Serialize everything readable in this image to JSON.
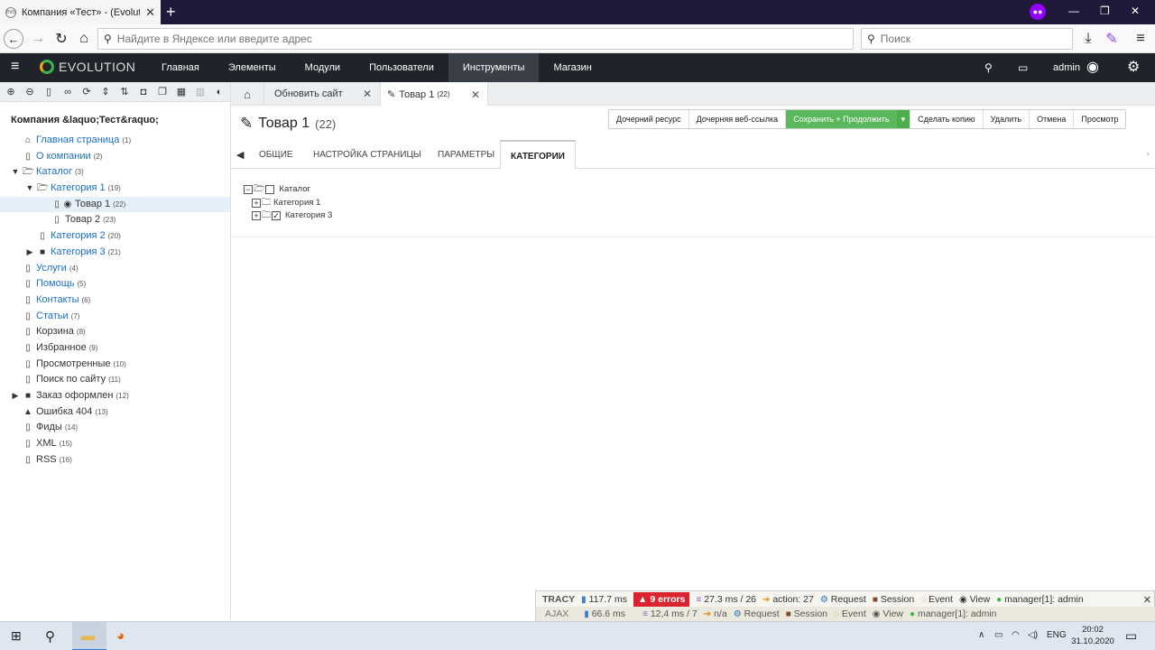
{
  "browser": {
    "tab_title": "Компания «Тест» - (Evolution",
    "favicon_label": "evo",
    "address_placeholder": "Найдите в Яндексе или введите адрес",
    "search_placeholder": "Поиск"
  },
  "evo_menu": {
    "logo": "EVOLUTION",
    "items": [
      "Главная",
      "Элементы",
      "Модули",
      "Пользователи",
      "Инструменты",
      "Магазин"
    ],
    "active_index": 4,
    "user": "admin"
  },
  "sidebar": {
    "site_title": "Компания &laquo;Тест&raquo;",
    "tree": [
      {
        "label": "Главная страница",
        "count": "(1)",
        "depth": 0,
        "toggle": "",
        "icon": "home",
        "link": true,
        "selected": false
      },
      {
        "label": "О компании",
        "count": "(2)",
        "depth": 0,
        "toggle": "",
        "icon": "file",
        "link": true,
        "selected": false
      },
      {
        "label": "Каталог",
        "count": "(3)",
        "depth": 0,
        "toggle": "down",
        "icon": "folder-open",
        "link": true,
        "selected": false
      },
      {
        "label": "Категория 1",
        "count": "(19)",
        "depth": 1,
        "toggle": "down",
        "icon": "folder-open",
        "link": true,
        "selected": false
      },
      {
        "label": "Товар 1",
        "count": "(22)",
        "depth": 2,
        "toggle": "",
        "icon": "file-eye",
        "link": false,
        "selected": true
      },
      {
        "label": "Товар 2",
        "count": "(23)",
        "depth": 2,
        "toggle": "",
        "icon": "file",
        "link": false,
        "selected": false
      },
      {
        "label": "Категория 2",
        "count": "(20)",
        "depth": 1,
        "toggle": "",
        "icon": "file",
        "link": true,
        "selected": false
      },
      {
        "label": "Категория 3",
        "count": "(21)",
        "depth": 1,
        "toggle": "right",
        "icon": "folder",
        "link": true,
        "selected": false
      },
      {
        "label": "Услуги",
        "count": "(4)",
        "depth": 0,
        "toggle": "",
        "icon": "file",
        "link": true,
        "selected": false
      },
      {
        "label": "Помощь",
        "count": "(5)",
        "depth": 0,
        "toggle": "",
        "icon": "file",
        "link": true,
        "selected": false
      },
      {
        "label": "Контакты",
        "count": "(6)",
        "depth": 0,
        "toggle": "",
        "icon": "file",
        "link": true,
        "selected": false
      },
      {
        "label": "Статьи",
        "count": "(7)",
        "depth": 0,
        "toggle": "",
        "icon": "file",
        "link": true,
        "selected": false
      },
      {
        "label": "Корзина",
        "count": "(8)",
        "depth": 0,
        "toggle": "",
        "icon": "file",
        "link": false,
        "selected": false
      },
      {
        "label": "Избранное",
        "count": "(9)",
        "depth": 0,
        "toggle": "",
        "icon": "file",
        "link": false,
        "selected": false
      },
      {
        "label": "Просмотренные",
        "count": "(10)",
        "depth": 0,
        "toggle": "",
        "icon": "file",
        "link": false,
        "selected": false
      },
      {
        "label": "Поиск по сайту",
        "count": "(11)",
        "depth": 0,
        "toggle": "",
        "icon": "file",
        "link": false,
        "selected": false
      },
      {
        "label": "Заказ оформлен",
        "count": "(12)",
        "depth": 0,
        "toggle": "right",
        "icon": "folder",
        "link": false,
        "selected": false
      },
      {
        "label": "Ошибка 404",
        "count": "(13)",
        "depth": 0,
        "toggle": "",
        "icon": "warning",
        "link": false,
        "selected": false
      },
      {
        "label": "Фиды",
        "count": "(14)",
        "depth": 0,
        "toggle": "",
        "icon": "file",
        "link": false,
        "selected": false
      },
      {
        "label": "XML",
        "count": "(15)",
        "depth": 0,
        "toggle": "",
        "icon": "file-code",
        "link": false,
        "selected": false
      },
      {
        "label": "RSS",
        "count": "(16)",
        "depth": 0,
        "toggle": "",
        "icon": "file-code",
        "link": false,
        "selected": false
      }
    ]
  },
  "content_tabs": {
    "tab1": "Обновить сайт",
    "tab2_title": "Товар 1",
    "tab2_count": "(22)"
  },
  "document": {
    "title": "Товар 1",
    "id": "(22)",
    "actions": [
      "Дочерний ресурс",
      "Дочерняя веб-ссылка",
      "Сохранить + Продолжить",
      "Сделать копию",
      "Удалить",
      "Отмена",
      "Просмотр"
    ],
    "tabs": [
      "ОБЩИЕ",
      "НАСТРОЙКА СТРАНИЦЫ",
      "ПАРАМЕТРЫ",
      "КАТЕГОРИИ"
    ],
    "active_tab": 3
  },
  "categories_tree": [
    {
      "label": "Каталог",
      "expander": "−",
      "checked": false,
      "depth": 0,
      "open": true
    },
    {
      "label": "Категория 1",
      "expander": "+",
      "checked": null,
      "depth": 1,
      "open": false
    },
    {
      "label": "Категория 3",
      "expander": "+",
      "checked": true,
      "depth": 1,
      "open": false
    }
  ],
  "tracy": {
    "row1": {
      "brand": "TRACY",
      "time": "117.7 ms",
      "errors": "9 errors",
      "db": "27.3 ms / 26",
      "action": "action: 27",
      "request": "Request",
      "session": "Session",
      "event": "Event",
      "view": "View",
      "user": "manager[1]: admin"
    },
    "row2": {
      "brand": "AJAX",
      "time": "66.6 ms",
      "db": "12,4 ms / 7",
      "action": "n/a",
      "request": "Request",
      "session": "Session",
      "event": "Event",
      "view": "View",
      "user": "manager[1]: admin"
    }
  },
  "taskbar": {
    "lang": "ENG",
    "time": "20:02",
    "date": "31.10.2020"
  }
}
